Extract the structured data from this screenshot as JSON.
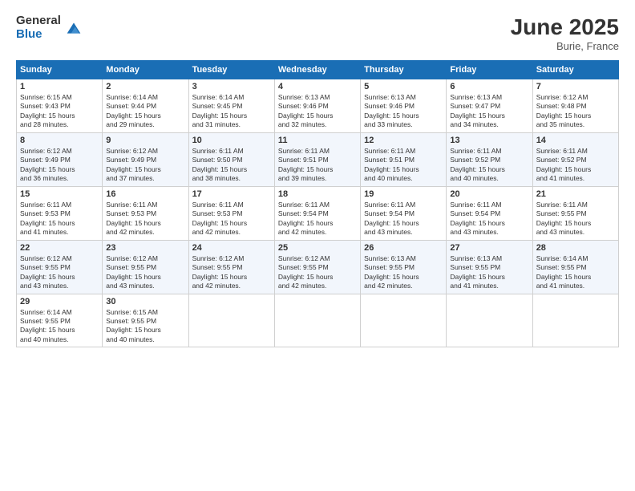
{
  "logo": {
    "general": "General",
    "blue": "Blue"
  },
  "header": {
    "month": "June 2025",
    "location": "Burie, France"
  },
  "days": [
    "Sunday",
    "Monday",
    "Tuesday",
    "Wednesday",
    "Thursday",
    "Friday",
    "Saturday"
  ],
  "weeks": [
    [
      {
        "day": "1",
        "sunrise": "6:15 AM",
        "sunset": "9:43 PM",
        "daylight": "15 hours and 28 minutes."
      },
      {
        "day": "2",
        "sunrise": "6:14 AM",
        "sunset": "9:44 PM",
        "daylight": "15 hours and 29 minutes."
      },
      {
        "day": "3",
        "sunrise": "6:14 AM",
        "sunset": "9:45 PM",
        "daylight": "15 hours and 31 minutes."
      },
      {
        "day": "4",
        "sunrise": "6:13 AM",
        "sunset": "9:46 PM",
        "daylight": "15 hours and 32 minutes."
      },
      {
        "day": "5",
        "sunrise": "6:13 AM",
        "sunset": "9:46 PM",
        "daylight": "15 hours and 33 minutes."
      },
      {
        "day": "6",
        "sunrise": "6:13 AM",
        "sunset": "9:47 PM",
        "daylight": "15 hours and 34 minutes."
      },
      {
        "day": "7",
        "sunrise": "6:12 AM",
        "sunset": "9:48 PM",
        "daylight": "15 hours and 35 minutes."
      }
    ],
    [
      {
        "day": "8",
        "sunrise": "6:12 AM",
        "sunset": "9:49 PM",
        "daylight": "15 hours and 36 minutes."
      },
      {
        "day": "9",
        "sunrise": "6:12 AM",
        "sunset": "9:49 PM",
        "daylight": "15 hours and 37 minutes."
      },
      {
        "day": "10",
        "sunrise": "6:11 AM",
        "sunset": "9:50 PM",
        "daylight": "15 hours and 38 minutes."
      },
      {
        "day": "11",
        "sunrise": "6:11 AM",
        "sunset": "9:51 PM",
        "daylight": "15 hours and 39 minutes."
      },
      {
        "day": "12",
        "sunrise": "6:11 AM",
        "sunset": "9:51 PM",
        "daylight": "15 hours and 40 minutes."
      },
      {
        "day": "13",
        "sunrise": "6:11 AM",
        "sunset": "9:52 PM",
        "daylight": "15 hours and 40 minutes."
      },
      {
        "day": "14",
        "sunrise": "6:11 AM",
        "sunset": "9:52 PM",
        "daylight": "15 hours and 41 minutes."
      }
    ],
    [
      {
        "day": "15",
        "sunrise": "6:11 AM",
        "sunset": "9:53 PM",
        "daylight": "15 hours and 41 minutes."
      },
      {
        "day": "16",
        "sunrise": "6:11 AM",
        "sunset": "9:53 PM",
        "daylight": "15 hours and 42 minutes."
      },
      {
        "day": "17",
        "sunrise": "6:11 AM",
        "sunset": "9:53 PM",
        "daylight": "15 hours and 42 minutes."
      },
      {
        "day": "18",
        "sunrise": "6:11 AM",
        "sunset": "9:54 PM",
        "daylight": "15 hours and 42 minutes."
      },
      {
        "day": "19",
        "sunrise": "6:11 AM",
        "sunset": "9:54 PM",
        "daylight": "15 hours and 43 minutes."
      },
      {
        "day": "20",
        "sunrise": "6:11 AM",
        "sunset": "9:54 PM",
        "daylight": "15 hours and 43 minutes."
      },
      {
        "day": "21",
        "sunrise": "6:11 AM",
        "sunset": "9:55 PM",
        "daylight": "15 hours and 43 minutes."
      }
    ],
    [
      {
        "day": "22",
        "sunrise": "6:12 AM",
        "sunset": "9:55 PM",
        "daylight": "15 hours and 43 minutes."
      },
      {
        "day": "23",
        "sunrise": "6:12 AM",
        "sunset": "9:55 PM",
        "daylight": "15 hours and 43 minutes."
      },
      {
        "day": "24",
        "sunrise": "6:12 AM",
        "sunset": "9:55 PM",
        "daylight": "15 hours and 42 minutes."
      },
      {
        "day": "25",
        "sunrise": "6:12 AM",
        "sunset": "9:55 PM",
        "daylight": "15 hours and 42 minutes."
      },
      {
        "day": "26",
        "sunrise": "6:13 AM",
        "sunset": "9:55 PM",
        "daylight": "15 hours and 42 minutes."
      },
      {
        "day": "27",
        "sunrise": "6:13 AM",
        "sunset": "9:55 PM",
        "daylight": "15 hours and 41 minutes."
      },
      {
        "day": "28",
        "sunrise": "6:14 AM",
        "sunset": "9:55 PM",
        "daylight": "15 hours and 41 minutes."
      }
    ],
    [
      {
        "day": "29",
        "sunrise": "6:14 AM",
        "sunset": "9:55 PM",
        "daylight": "15 hours and 40 minutes."
      },
      {
        "day": "30",
        "sunrise": "6:15 AM",
        "sunset": "9:55 PM",
        "daylight": "15 hours and 40 minutes."
      },
      null,
      null,
      null,
      null,
      null
    ]
  ]
}
